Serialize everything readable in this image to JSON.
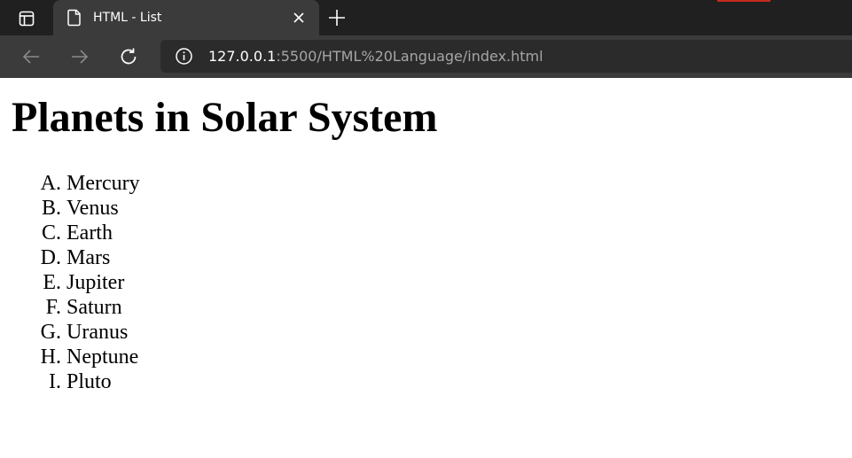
{
  "browser": {
    "tab": {
      "title": "HTML - List"
    },
    "address": {
      "host": "127.0.0.1",
      "path": ":5500/HTML%20Language/index.html"
    },
    "icons": {
      "sidebar": "sidebar-toggle-icon",
      "page": "page-icon",
      "close": "close-icon",
      "new_tab": "plus-icon",
      "back": "arrow-left-icon",
      "forward": "arrow-right-icon",
      "reload": "reload-icon",
      "site_info": "info-icon"
    },
    "colors": {
      "tabbar": "#202020",
      "active_tab": "#3b3b3b",
      "address_bar": "#2b2b2b"
    }
  },
  "page": {
    "title": "Planets in Solar System",
    "planets": [
      {
        "marker": "A.",
        "name": "Mercury"
      },
      {
        "marker": "B.",
        "name": "Venus"
      },
      {
        "marker": "C.",
        "name": "Earth"
      },
      {
        "marker": "D.",
        "name": "Mars"
      },
      {
        "marker": "E.",
        "name": "Jupiter"
      },
      {
        "marker": "F.",
        "name": "Saturn"
      },
      {
        "marker": "G.",
        "name": "Uranus"
      },
      {
        "marker": "H.",
        "name": "Neptune"
      },
      {
        "marker": "I.",
        "name": "Pluto"
      }
    ]
  }
}
